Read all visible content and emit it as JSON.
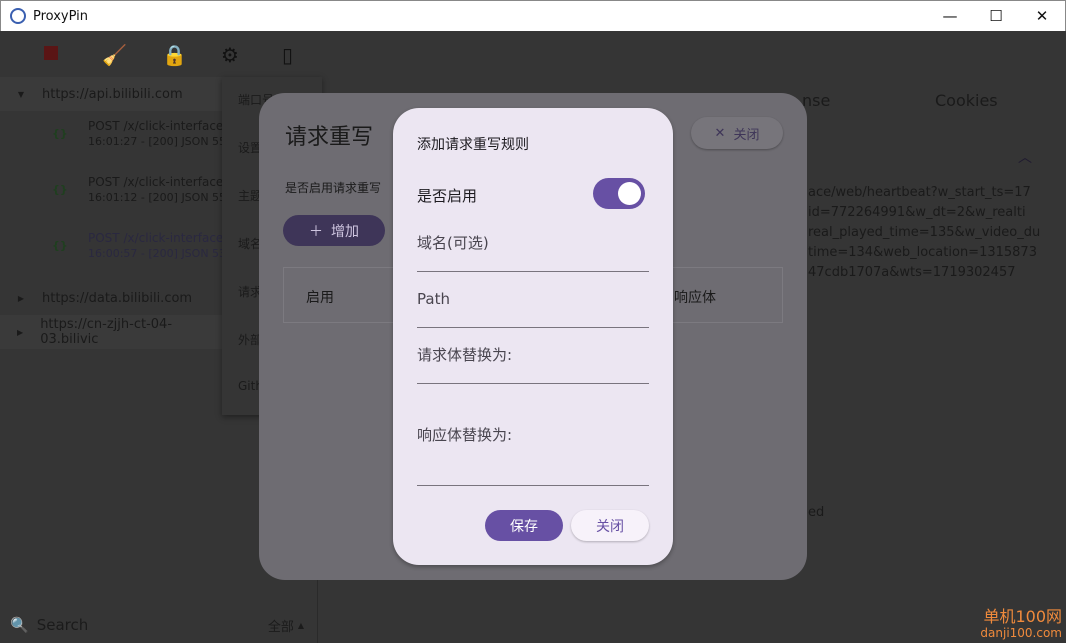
{
  "window": {
    "title": "ProxyPin",
    "controls": [
      "—",
      "☐",
      "✕"
    ]
  },
  "toolbar": {
    "icons": [
      "stop-icon",
      "broom-icon",
      "lock-icon",
      "gear-icon",
      "phone-icon"
    ]
  },
  "hosts": [
    {
      "label": "https://api.bilibili.com",
      "expanded": true
    },
    {
      "label": "https://data.bilibili.com",
      "expanded": false
    },
    {
      "label": "https://cn-zjjh-ct-04-03.bilivic",
      "expanded": false
    }
  ],
  "requests": [
    {
      "line1": "POST /x/click-interface/",
      "line2": "16:01:27 - [200]  JSON 55"
    },
    {
      "line1": "POST /x/click-interface/",
      "line2": "16:01:12 - [200]  JSON 55"
    },
    {
      "line1": "POST /x/click-interface/",
      "line2": "16:00:57 - [200]  JSON 53"
    }
  ],
  "settings_menu": [
    "端口号",
    "设置",
    "主题",
    "域名",
    "请求",
    "外部",
    "Gith"
  ],
  "search": {
    "placeholder": "Search",
    "filter": "全部"
  },
  "tabs": {
    "response": "nse",
    "cookies": "Cookies"
  },
  "url_text": "ace/web/heartbeat?w_start_ts=17\nid=772264991&w_dt=2&w_realti\nreal_played_time=135&w_video_du\ntime=134&web_location=1315873\n47cdb1707a&wts=1719302457",
  "trailing_text": "ed",
  "rewrite_dialog": {
    "title": "请求重写",
    "enable_label": "是否启用请求重写",
    "add": "增加",
    "close": "关闭",
    "columns": [
      "启用",
      "响应体"
    ]
  },
  "rule_dialog": {
    "title": "添加请求重写规则",
    "enabled_label": "是否启用",
    "enabled": true,
    "domain": "域名(可选)",
    "path": "Path",
    "request_body": "请求体替换为:",
    "response_body": "响应体替换为:",
    "save": "保存",
    "close": "关闭"
  },
  "watermark": {
    "line1": "单机100网",
    "line2": "danji100.com"
  },
  "colors": {
    "accent": "#6750a4",
    "dialog": "#ece6f2",
    "stop": "#8b1a1a"
  }
}
